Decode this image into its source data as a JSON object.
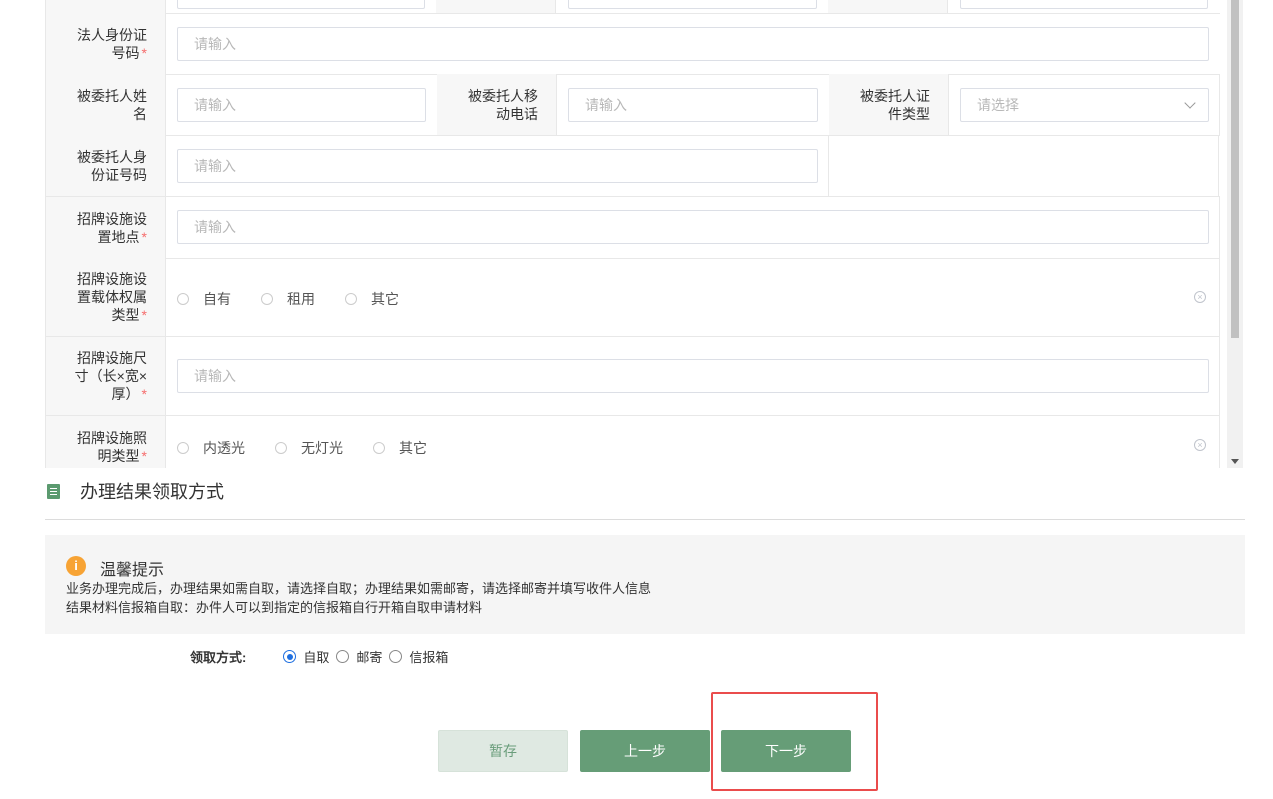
{
  "placeholders": {
    "input": "请输入",
    "select": "请选择"
  },
  "form": {
    "legal_id_label": "法人身份证号码",
    "delegate_name_label": "被委托人姓名",
    "delegate_phone_label": "被委托人移动电话",
    "delegate_idtype_label": "被委托人证件类型",
    "delegate_id_label": "被委托人身份证号码",
    "sign_location_label": "招牌设施设置地点",
    "carrier_type_label": "招牌设施设置载体权属类型",
    "carrier_options": [
      "自有",
      "租用",
      "其它"
    ],
    "size_label": "招牌设施尺寸（长×宽×厚）",
    "lighting_label": "招牌设施照明类型",
    "lighting_options": [
      "内透光",
      "无灯光",
      "其它"
    ],
    "required_mark": "*"
  },
  "section": {
    "title": "办理结果领取方式",
    "tip_title": "温馨提示",
    "tip_line1": "业务办理完成后，办理结果如需自取，请选择自取；办理结果如需邮寄，请选择邮寄并填写收件人信息",
    "tip_line2": "结果材料信报箱自取：办件人可以到指定的信报箱自行开箱自取申请材料"
  },
  "pickup": {
    "label": "领取方式:",
    "options": [
      "自取",
      "邮寄",
      "信报箱"
    ],
    "selected": "自取"
  },
  "buttons": {
    "save": "暂存",
    "prev": "上一步",
    "next": "下一步"
  },
  "colors": {
    "primary": "#669d77",
    "accent_warning": "#f7a334",
    "highlight": "#ea4c4c",
    "radio_selected": "#1e6fe0"
  }
}
